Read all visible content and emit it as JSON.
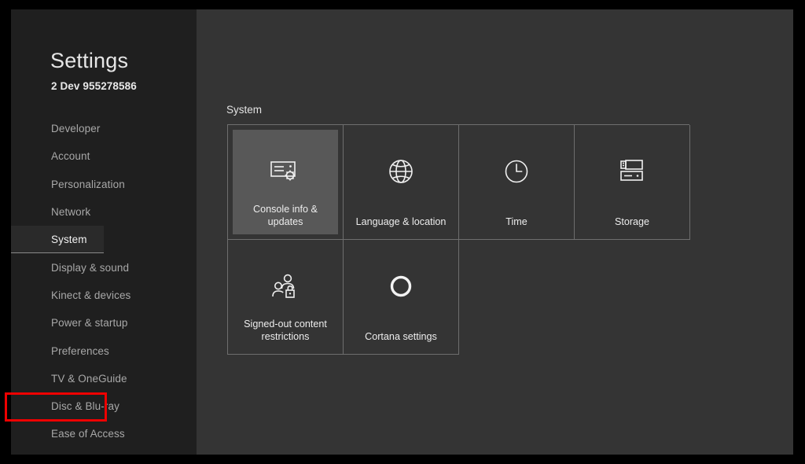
{
  "window": {
    "background_color": "#000000",
    "screen_background": "#343434"
  },
  "sidebar": {
    "title": "Settings",
    "gamertag": "2 Dev 955278586",
    "background_color": "#1f1f1f",
    "highlight_color": "#ee0000",
    "items": [
      {
        "label": "Developer",
        "selected": false,
        "boxed": false
      },
      {
        "label": "Account",
        "selected": false,
        "boxed": false
      },
      {
        "label": "Personalization",
        "selected": false,
        "boxed": false
      },
      {
        "label": "Network",
        "selected": false,
        "boxed": false
      },
      {
        "label": "System",
        "selected": true,
        "boxed": false
      },
      {
        "label": "Display & sound",
        "selected": false,
        "boxed": false
      },
      {
        "label": "Kinect & devices",
        "selected": false,
        "boxed": false
      },
      {
        "label": "Power & startup",
        "selected": false,
        "boxed": false
      },
      {
        "label": "Preferences",
        "selected": false,
        "boxed": false
      },
      {
        "label": "TV & OneGuide",
        "selected": false,
        "boxed": false
      },
      {
        "label": "Disc & Blu-ray",
        "selected": false,
        "boxed": true
      },
      {
        "label": "Ease of Access",
        "selected": false,
        "boxed": false
      }
    ]
  },
  "main": {
    "section_label": "System",
    "tiles": [
      {
        "label": "Console info & updates",
        "icon": "console-gear-icon",
        "active": true
      },
      {
        "label": "Language & location",
        "icon": "globe-icon",
        "active": false
      },
      {
        "label": "Time",
        "icon": "clock-icon",
        "active": false
      },
      {
        "label": "Storage",
        "icon": "storage-drives-icon",
        "active": false
      },
      {
        "label": "Signed-out content restrictions",
        "icon": "people-lock-icon",
        "active": false
      },
      {
        "label": "Cortana settings",
        "icon": "cortana-ring-icon",
        "active": false
      }
    ]
  }
}
